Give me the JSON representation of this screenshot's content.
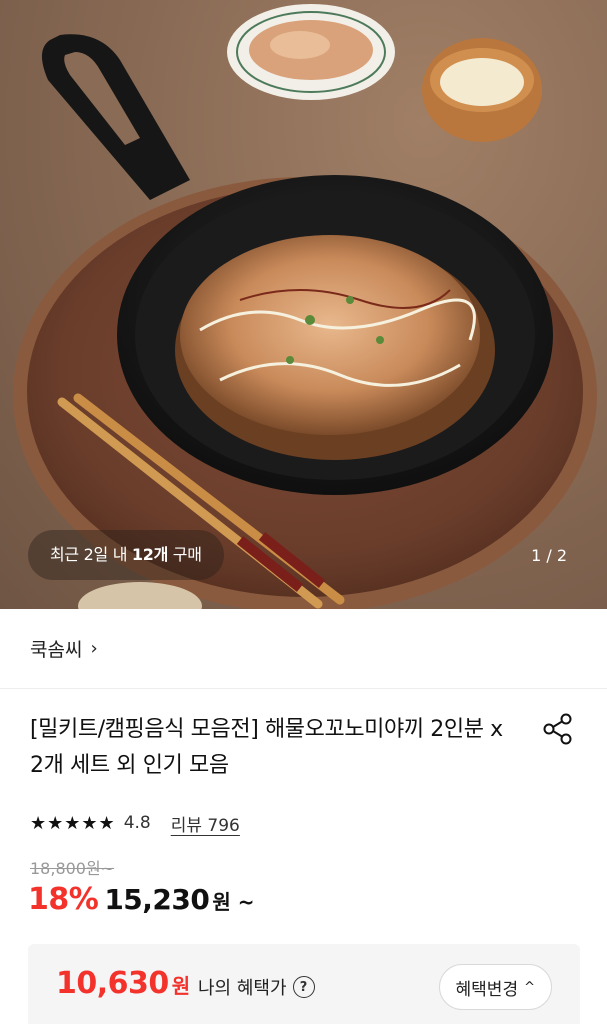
{
  "gallery": {
    "purchase_prefix": "최근 2일 내 ",
    "purchase_count": "12개",
    "purchase_suffix": " 구매",
    "page_indicator": "1 / 2"
  },
  "seller": {
    "name": "쿡솜씨",
    "chevron": "›"
  },
  "product": {
    "title": "[밀키트/캠핑음식 모음전] 해물오꼬노미야끼 2인분 x 2개 세트 외 인기 모음",
    "rating_stars": "★★★★★",
    "rating_value": "4.8",
    "review_label": "리뷰 796",
    "original_price": "18,800원~",
    "discount_rate": "18%",
    "sale_price": "15,230",
    "sale_unit": "원 ~"
  },
  "benefit": {
    "price": "10,630",
    "unit": "원",
    "label": "나의 혜택가",
    "help": "?",
    "change_label": "혜택변경",
    "change_chevron": "^"
  },
  "colors": {
    "accent_red": "#f2322b",
    "background_gray": "#f5f5f6"
  },
  "icons": [
    "share-icon",
    "help-icon",
    "chevron-right-icon",
    "chevron-up-icon",
    "star-icon"
  ]
}
